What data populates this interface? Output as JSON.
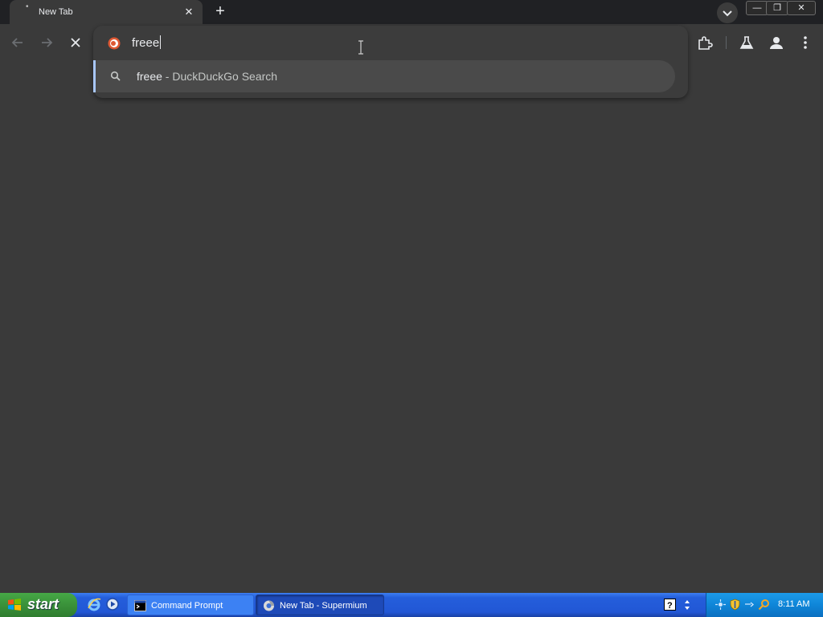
{
  "browser": {
    "tab": {
      "title": "New Tab",
      "close_glyph": "✕",
      "favicon_glyph": "•"
    },
    "new_tab_glyph": "+",
    "window_controls": {
      "minimize": "—",
      "restore": "❐",
      "close": "✕"
    },
    "toolbar": {
      "back_icon": "arrow-left-icon",
      "forward_icon": "arrow-right-icon",
      "stop_icon": "close-icon",
      "extensions_icon": "puzzle-icon",
      "labs_icon": "flask-icon",
      "profile_icon": "person-icon",
      "menu_icon": "kebab-menu-icon"
    },
    "omnibox": {
      "value": "freee",
      "search_engine_icon": "duckduckgo-icon",
      "suggestions": [
        {
          "query": "freee",
          "suffix": " - DuckDuckGo Search",
          "icon": "search-icon"
        }
      ]
    }
  },
  "taskbar": {
    "start_label": "start",
    "tasks": [
      {
        "label": "Command Prompt",
        "icon": "cmd-icon"
      },
      {
        "label": "New Tab - Supermium",
        "icon": "browser-icon"
      }
    ],
    "clock": "8:11 AM"
  },
  "colors": {
    "accent": "#a8c7fa",
    "page_bg": "#3a3a3a",
    "tabstrip_bg": "#202124",
    "taskbar_blue": "#245edb",
    "start_green": "#3c963c"
  }
}
